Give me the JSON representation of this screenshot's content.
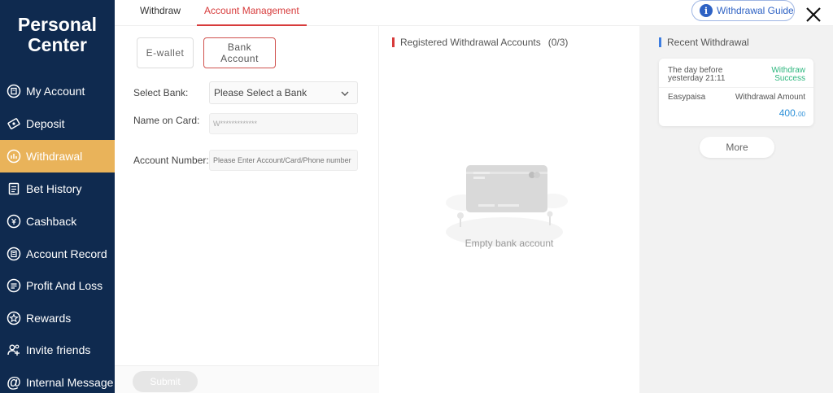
{
  "sidebar": {
    "title_line1": "Personal",
    "title_line2": "Center",
    "items": [
      {
        "label": "My Account",
        "icon": "account-icon"
      },
      {
        "label": "Deposit",
        "icon": "deposit-icon"
      },
      {
        "label": "Withdrawal",
        "icon": "withdrawal-icon",
        "active": true
      },
      {
        "label": "Bet History",
        "icon": "bet-history-icon"
      },
      {
        "label": "Cashback",
        "icon": "cashback-icon"
      },
      {
        "label": "Account Record",
        "icon": "account-record-icon"
      },
      {
        "label": "Profit And Loss",
        "icon": "profit-loss-icon"
      },
      {
        "label": "Rewards",
        "icon": "rewards-icon"
      },
      {
        "label": "Invite friends",
        "icon": "invite-friends-icon"
      },
      {
        "label": "Internal Message",
        "icon": "at-icon"
      }
    ]
  },
  "tabs": [
    {
      "label": "Withdraw",
      "active": false
    },
    {
      "label": "Account Management",
      "active": true
    }
  ],
  "guide_button": {
    "label": "Withdrawal Guide",
    "icon": "info-icon"
  },
  "form": {
    "type_buttons": [
      {
        "label": "E-wallet",
        "active": false
      },
      {
        "label_line1": "Bank",
        "label_line2": "Account",
        "active": true
      }
    ],
    "select_bank_label": "Select Bank:",
    "select_bank_value": "Please Select a Bank",
    "name_on_card_label": "Name on Card:",
    "name_on_card_value": "W*************",
    "account_number_label": "Account Number:",
    "account_number_placeholder": "Please Enter Account/Card/Phone number",
    "submit_label": "Submit"
  },
  "registered": {
    "title": "Registered Withdrawal Accounts",
    "count": "(0/3)",
    "empty_text": "Empty bank account"
  },
  "recent": {
    "title": "Recent Withdrawal",
    "record": {
      "date_line1": "The day before",
      "date_line2": "yesterday 21:11",
      "status_line1": "Withdraw",
      "status_line2": "Success",
      "method": "Easypaisa",
      "amount_label": "Withdrawal Amount",
      "amount_int": "400.",
      "amount_dec": "00"
    },
    "more_label": "More"
  },
  "colors": {
    "sidebar_bg": "#0f2a4f",
    "active_nav": "#e9b35a",
    "accent_red": "#d73b3b",
    "success_green": "#2cb67d",
    "amount_blue": "#2a8fd8",
    "guide_blue": "#2e62c4"
  }
}
